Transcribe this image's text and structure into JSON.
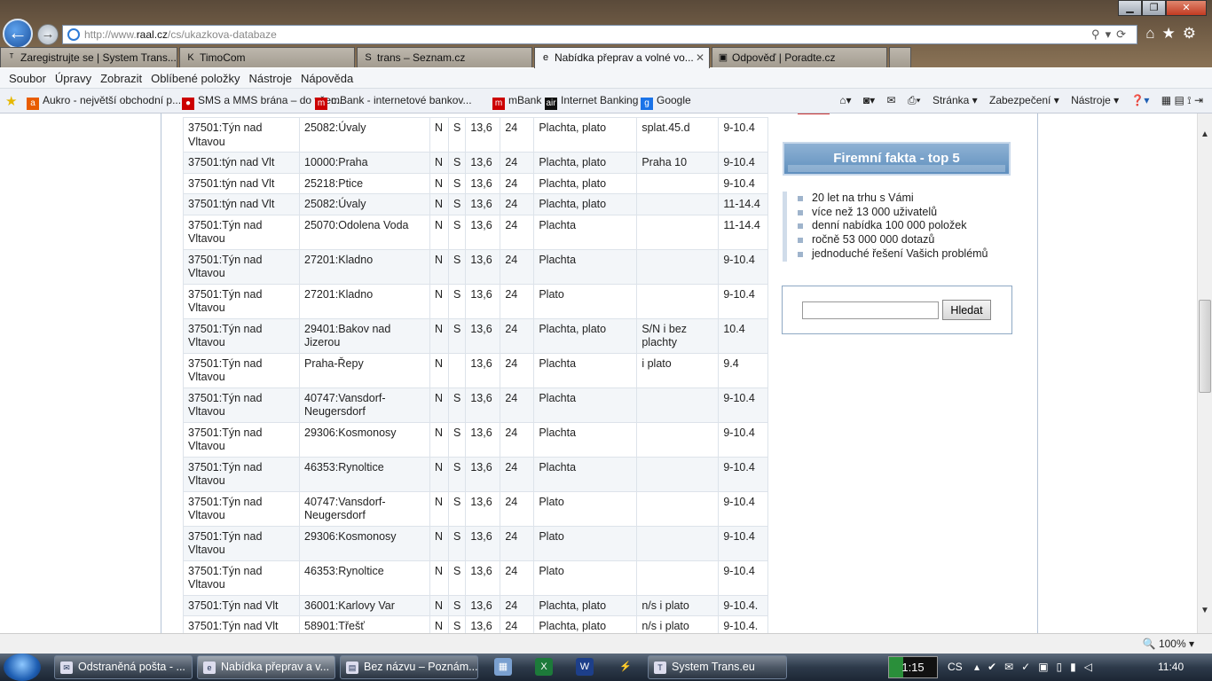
{
  "browser": {
    "url_prefix": "http://www.",
    "url_domain": "raal.cz",
    "url_path": "/cs/ukazkova-databaze",
    "tabs": [
      {
        "label": "Zaregistrujte se | System Trans...",
        "icon": "ᵀ"
      },
      {
        "label": "TimoCom",
        "icon": "K"
      },
      {
        "label": "trans – Seznam.cz",
        "icon": "S"
      },
      {
        "label": "Nabídka přeprav a volné vo...",
        "icon": "e",
        "close": "✕"
      },
      {
        "label": "Odpověď | Poradte.cz",
        "icon": "▣"
      }
    ],
    "menu": [
      "Soubor",
      "Úpravy",
      "Zobrazit",
      "Oblíbené položky",
      "Nástroje",
      "Nápověda"
    ],
    "favorites": [
      {
        "label": "Aukro - největší obchodní p...",
        "icon": "a"
      },
      {
        "label": "SMS a MMS brána – do všec...",
        "icon": "●"
      },
      {
        "label": "mBank - internetové bankov...",
        "icon": "m"
      },
      {
        "label": "mBank",
        "icon": "m"
      },
      {
        "label": "Internet Banking",
        "icon": "air"
      },
      {
        "label": "Google",
        "icon": "g"
      }
    ],
    "commands": [
      "Stránka ▾",
      "Zabezpečení ▾",
      "Nástroje ▾"
    ],
    "zoom": "100%"
  },
  "table_rows": [
    [
      "37501:Týn nad Vltavou",
      "25082:Úvaly",
      "N",
      "S",
      "13,6",
      "24",
      "Plachta, plato",
      "splat.45.d",
      "9-10.4"
    ],
    [
      "37501:týn nad Vlt",
      "10000:Praha",
      "N",
      "S",
      "13,6",
      "24",
      "Plachta, plato",
      "Praha 10",
      "9-10.4"
    ],
    [
      "37501:týn nad Vlt",
      "25218:Ptice",
      "N",
      "S",
      "13,6",
      "24",
      "Plachta, plato",
      "",
      "9-10.4"
    ],
    [
      "37501:týn nad Vlt",
      "25082:Úvaly",
      "N",
      "S",
      "13,6",
      "24",
      "Plachta, plato",
      "",
      "11-14.4"
    ],
    [
      "37501:Týn nad Vltavou",
      "25070:Odolena Voda",
      "N",
      "S",
      "13,6",
      "24",
      "Plachta",
      "",
      "11-14.4"
    ],
    [
      "37501:Týn nad Vltavou",
      "27201:Kladno",
      "N",
      "S",
      "13,6",
      "24",
      "Plachta",
      "",
      "9-10.4"
    ],
    [
      "37501:Týn nad Vltavou",
      "27201:Kladno",
      "N",
      "S",
      "13,6",
      "24",
      "Plato",
      "",
      "9-10.4"
    ],
    [
      "37501:Týn nad Vltavou",
      "29401:Bakov nad Jizerou",
      "N",
      "S",
      "13,6",
      "24",
      "Plachta, plato",
      "S/N i bez plachty",
      "10.4"
    ],
    [
      "37501:Týn nad Vltavou",
      "Praha-Řepy",
      "N",
      "",
      "13,6",
      "24",
      "Plachta",
      "i plato",
      "9.4"
    ],
    [
      "37501:Týn nad Vltavou",
      "40747:Vansdorf-Neugersdorf",
      "N",
      "S",
      "13,6",
      "24",
      "Plachta",
      "",
      "9-10.4"
    ],
    [
      "37501:Týn nad Vltavou",
      "29306:Kosmonosy",
      "N",
      "S",
      "13,6",
      "24",
      "Plachta",
      "",
      "9-10.4"
    ],
    [
      "37501:Týn nad Vltavou",
      "46353:Rynoltice",
      "N",
      "S",
      "13,6",
      "24",
      "Plachta",
      "",
      "9-10.4"
    ],
    [
      "37501:Týn nad Vltavou",
      "40747:Vansdorf-Neugersdorf",
      "N",
      "S",
      "13,6",
      "24",
      "Plato",
      "",
      "9-10.4"
    ],
    [
      "37501:Týn nad Vltavou",
      "29306:Kosmonosy",
      "N",
      "S",
      "13,6",
      "24",
      "Plato",
      "",
      "9-10.4"
    ],
    [
      "37501:Týn nad Vltavou",
      "46353:Rynoltice",
      "N",
      "S",
      "13,6",
      "24",
      "Plato",
      "",
      "9-10.4"
    ],
    [
      "37501:Týn nad Vlt",
      "36001:Karlovy Var",
      "N",
      "S",
      "13,6",
      "24",
      "Plachta, plato",
      "n/s i plato",
      "9-10.4."
    ],
    [
      "37501:Týn nad Vlt",
      "58901:Třešť",
      "N",
      "S",
      "13,6",
      "24",
      "Plachta, plato",
      "n/s i plato",
      "9-10.4."
    ]
  ],
  "sidebar": {
    "heading": "Firemní fakta - top 5",
    "facts": [
      "20 let na trhu s Vámi",
      "více než 13 000 uživatelů",
      "denní nabídka 100 000 položek",
      "ročně 53 000 000 dotazů",
      "jednoduché řešení Vašich problémů"
    ],
    "search_button": "Hledat",
    "search_value": ""
  },
  "taskbar": {
    "buttons": [
      {
        "label": "Odstraněná pošta - ...",
        "icon": "✉"
      },
      {
        "label": "Nabídka přeprav a v...",
        "icon": "e"
      },
      {
        "label": "Bez názvu – Poznám...",
        "icon": "▤"
      },
      {
        "label": "System Trans.eu",
        "icon": "T"
      }
    ],
    "clock_widget": "1:15",
    "lang": "CS",
    "time": "11:40"
  }
}
